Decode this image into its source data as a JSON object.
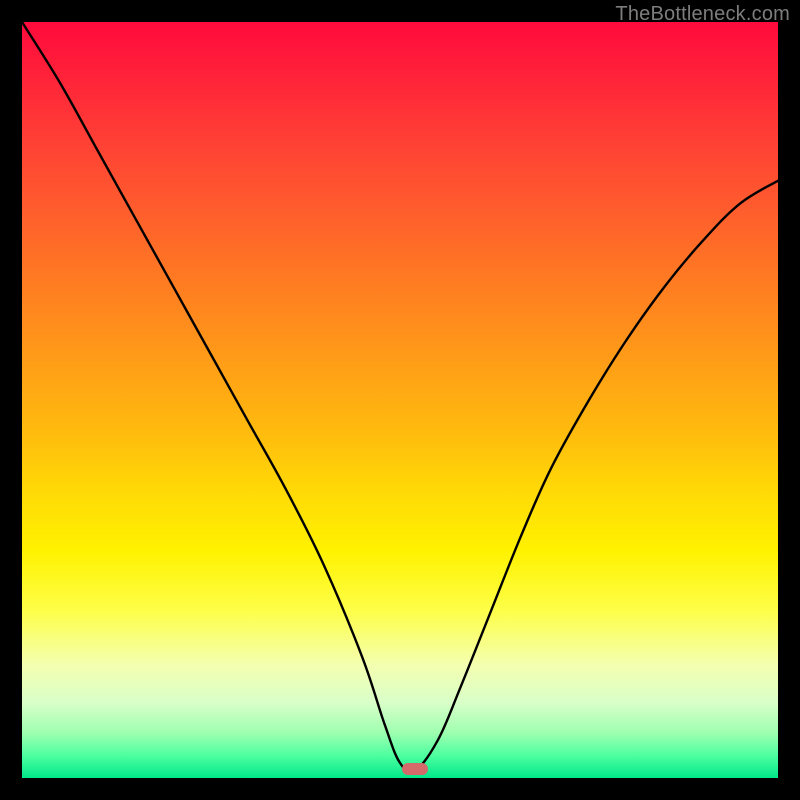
{
  "watermark": "TheBottleneck.com",
  "marker": {
    "x_pct": 52.0,
    "y_pct": 98.8
  },
  "colors": {
    "frame": "#000000",
    "curve": "#000000",
    "marker": "#d46a6a",
    "gradient_top": "#ff0a3c",
    "gradient_bottom": "#00e88a"
  },
  "chart_data": {
    "type": "line",
    "title": "",
    "xlabel": "",
    "ylabel": "",
    "xlim": [
      0,
      100
    ],
    "ylim": [
      0,
      100
    ],
    "note": "y is the vertical distance from the bottom of the gradient area (0 = bottom, 100 = top). Values read from the curve shape relative to the plot box.",
    "series": [
      {
        "name": "left-branch",
        "x": [
          0,
          5,
          10,
          15,
          20,
          25,
          30,
          35,
          40,
          45,
          48,
          50,
          52
        ],
        "y": [
          100,
          92,
          83,
          74,
          65,
          56,
          47,
          38,
          28,
          16,
          7,
          2,
          1
        ]
      },
      {
        "name": "right-branch",
        "x": [
          52,
          55,
          58,
          62,
          66,
          70,
          75,
          80,
          85,
          90,
          95,
          100
        ],
        "y": [
          1,
          5,
          12,
          22,
          32,
          41,
          50,
          58,
          65,
          71,
          76,
          79
        ]
      }
    ],
    "minimum_point": {
      "x": 52,
      "y": 1
    }
  }
}
